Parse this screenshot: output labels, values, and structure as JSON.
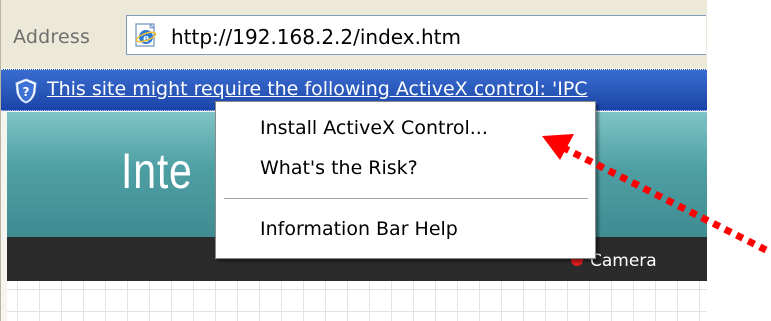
{
  "address_bar": {
    "label": "Address",
    "url": "http://192.168.2.2/index.htm"
  },
  "info_bar": {
    "text": "This site might require the following ActiveX control: 'IPC"
  },
  "page": {
    "banner_text": "Inte",
    "nav_item": "Camera"
  },
  "context_menu": {
    "items": [
      {
        "label": "Install ActiveX Control..."
      },
      {
        "label": "What's the Risk?"
      },
      {
        "label": "Information Bar Help"
      }
    ]
  },
  "colors": {
    "info_bar": "#1f4fb5",
    "arrow": "#ff0000",
    "banner": "#4e9fa3",
    "navbar": "#2b2b2b",
    "nav_dot": "#e01d1d"
  },
  "icons": {
    "address": "ie-page-icon",
    "info_bar": "shield-icon",
    "nav": "red-dot-icon"
  }
}
